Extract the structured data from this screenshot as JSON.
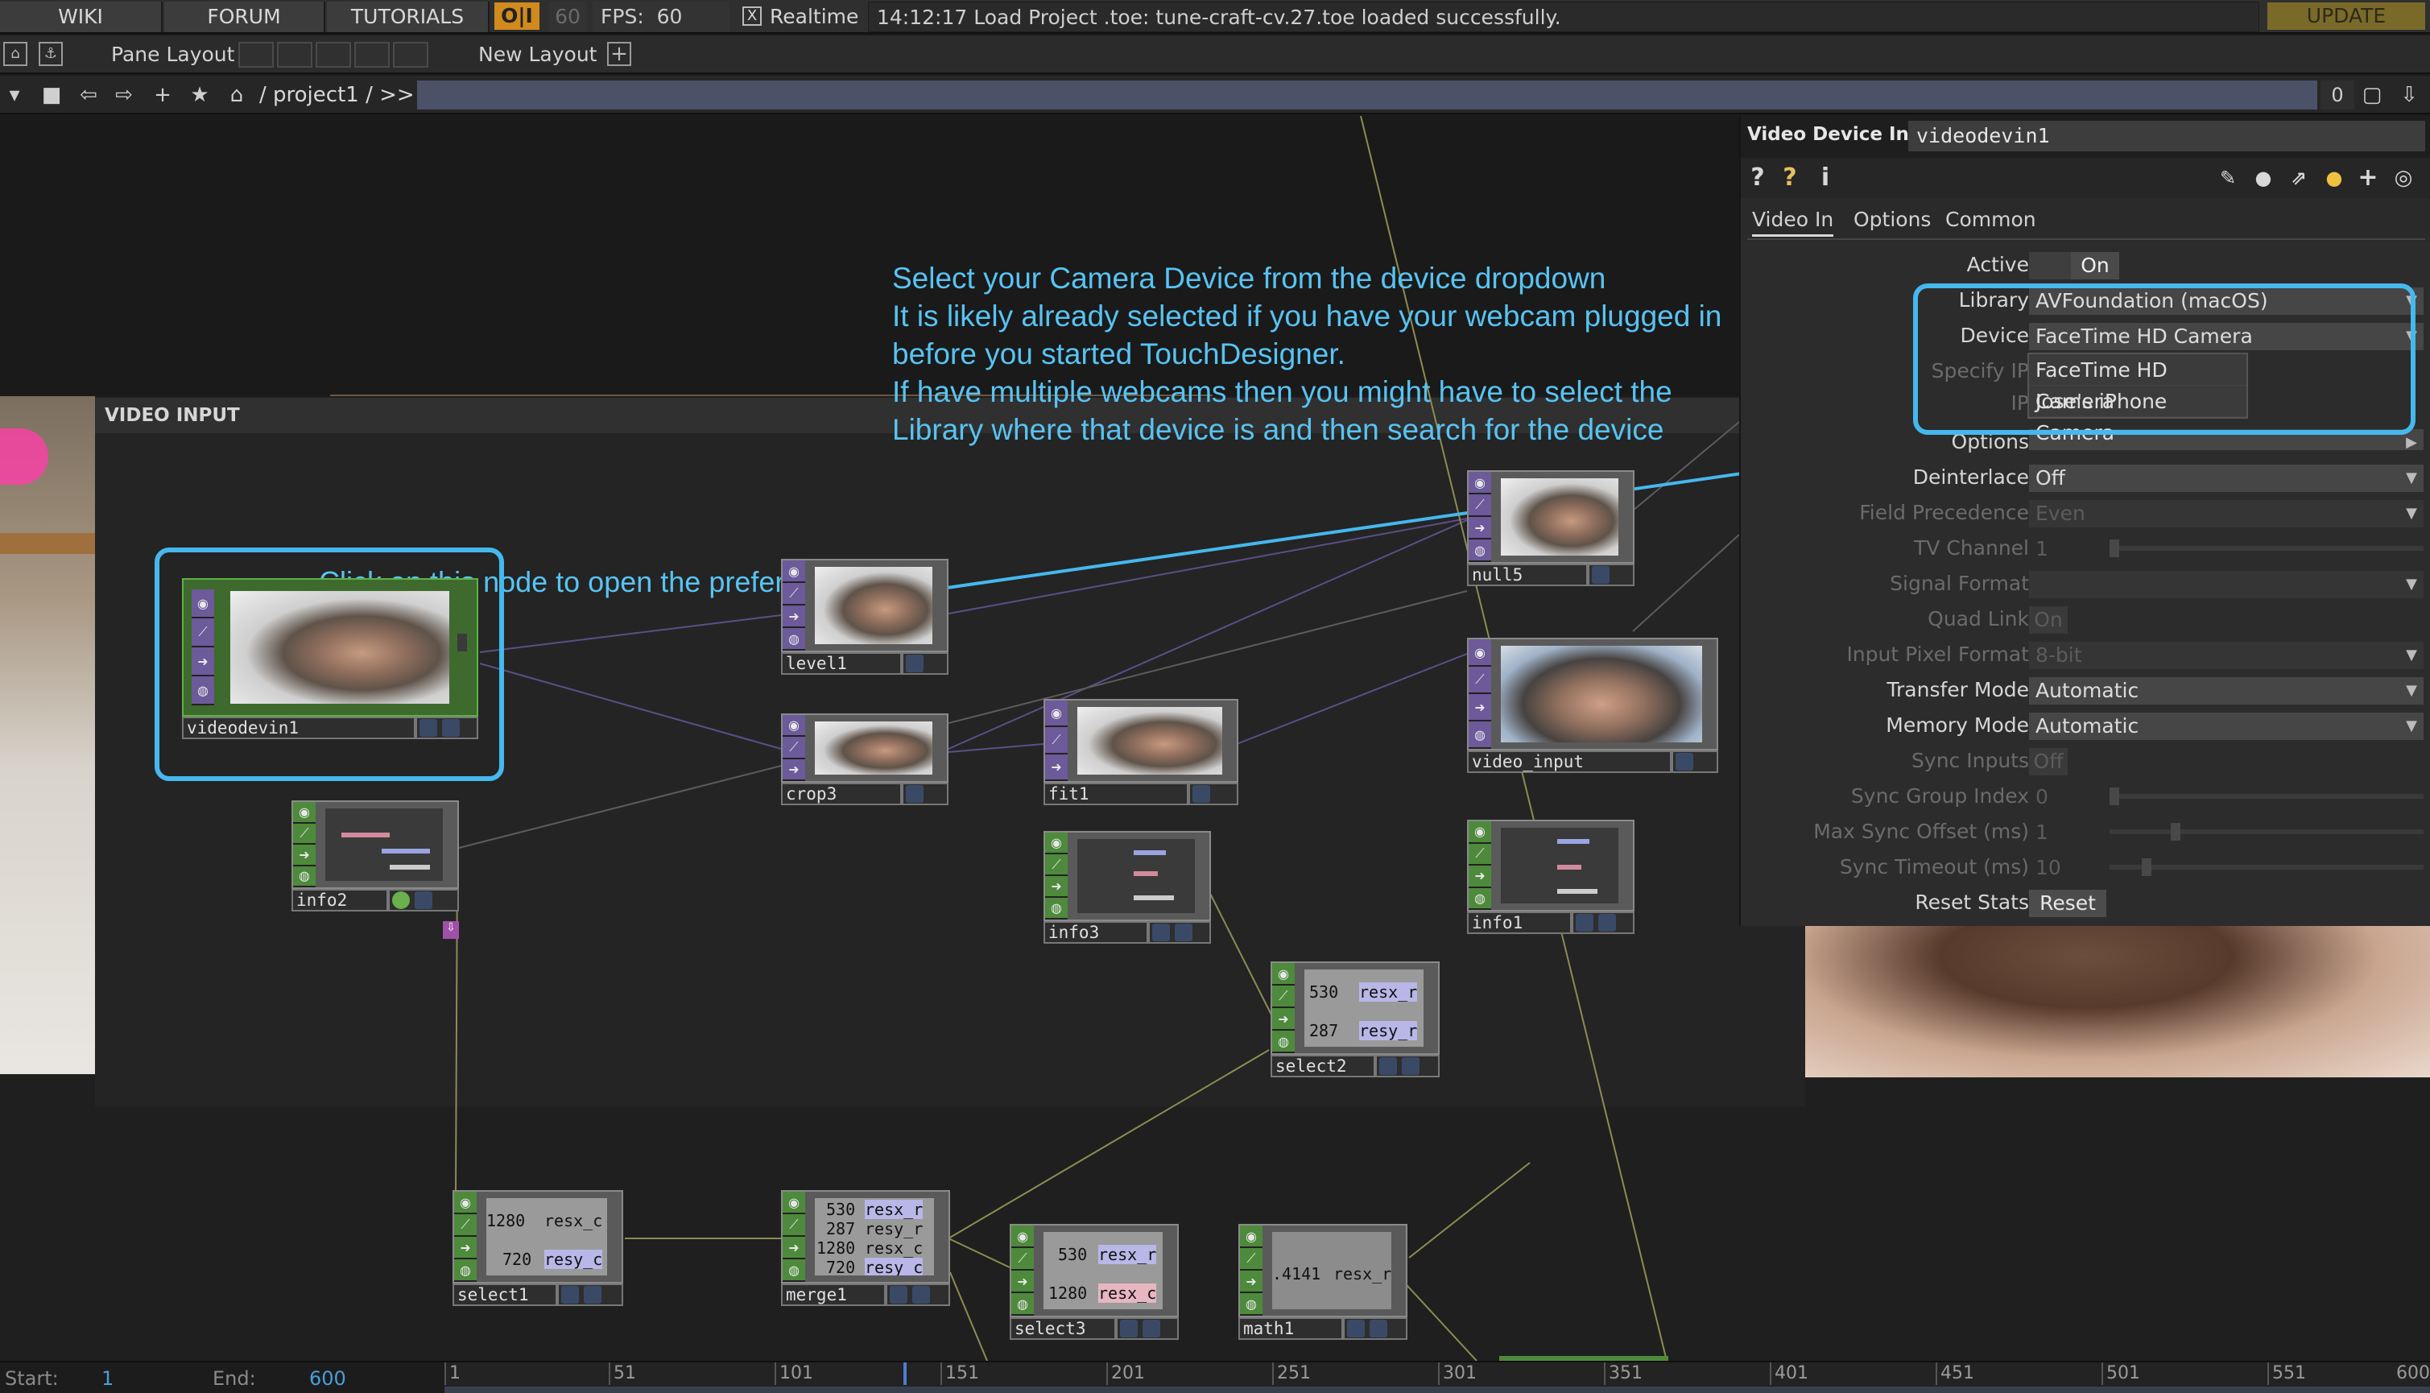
{
  "topbar": {
    "tabs": [
      "WIKI",
      "FORUM",
      "TUTORIALS"
    ],
    "oi": "O|I",
    "fps_dim": "60",
    "fps_label": "FPS:",
    "fps_value": "60",
    "realtime_check": "X",
    "realtime_label": "Realtime",
    "message": "14:12:17 Load Project .toe: tune-craft-cv.27.toe loaded successfully.",
    "update": "UPDATE"
  },
  "layoutbar": {
    "pane_layout": "Pane Layout",
    "new_layout": "New Layout",
    "add": "+"
  },
  "pathbar": {
    "path": "/ project1 / >>",
    "counter": "0"
  },
  "network": {
    "container_title": "VIDEO INPUT",
    "annotation_main": "Select your Camera Device from the device dropdown\nIt is likely already selected if you have your webcam plugged in before you started TouchDesigner.\nIf have multiple webcams then you might have to select the Library where that device is and then search for the device",
    "annotation_node": "Click on this node to open the preferences",
    "nodes": {
      "videodevin1": "videodevin1",
      "info2": "info2",
      "level1": "level1",
      "crop3": "crop3",
      "fit1": "fit1",
      "info3": "info3",
      "null5": "null5",
      "video_input": "video_input",
      "info1": "info1",
      "select2": "select2",
      "select1": "select1",
      "merge1": "merge1",
      "select3": "select3",
      "math1": "math1"
    },
    "chop_values": {
      "select2": [
        "530",
        "287"
      ],
      "select2_names": [
        "resx_r",
        "resy_r"
      ],
      "select1": [
        "1280",
        "720"
      ],
      "select1_names": [
        "resx_c",
        "resy_c"
      ],
      "merge1": [
        "530",
        "287",
        "1280",
        "720"
      ],
      "merge1_names": [
        "resx_r",
        "resy_r",
        "resx_c",
        "resy_c"
      ],
      "select3": [
        "530",
        "1280"
      ],
      "select3_names": [
        "resx_r",
        "resx_c"
      ],
      "math1": [
        ".4141"
      ],
      "math1_names": [
        "resx_r"
      ]
    }
  },
  "params": {
    "op_type": "Video Device In",
    "op_name": "videodevin1",
    "tabs": [
      "Video In",
      "Options",
      "Common"
    ],
    "rows": {
      "active": {
        "label": "Active",
        "value": "On"
      },
      "library": {
        "label": "Library",
        "value": "AVFoundation (macOS)"
      },
      "device": {
        "label": "Device",
        "value": "FaceTime HD Camera"
      },
      "specify_ip": {
        "label": "Specify IP"
      },
      "ip": {
        "label": "IP"
      },
      "options": {
        "label": "Options"
      },
      "deinterlace": {
        "label": "Deinterlace",
        "value": "Off"
      },
      "field_precedence": {
        "label": "Field Precedence",
        "value": "Even"
      },
      "tv_channel": {
        "label": "TV Channel",
        "value": "1"
      },
      "signal_format": {
        "label": "Signal Format",
        "value": ""
      },
      "quad_link": {
        "label": "Quad Link",
        "value": "On"
      },
      "input_pixel_format": {
        "label": "Input Pixel Format",
        "value": "8-bit"
      },
      "transfer_mode": {
        "label": "Transfer Mode",
        "value": "Automatic"
      },
      "memory_mode": {
        "label": "Memory Mode",
        "value": "Automatic"
      },
      "sync_inputs": {
        "label": "Sync Inputs",
        "value": "Off"
      },
      "sync_group_index": {
        "label": "Sync Group Index",
        "value": "0"
      },
      "max_sync_offset": {
        "label": "Max Sync Offset (ms)",
        "value": "1"
      },
      "sync_timeout": {
        "label": "Sync Timeout (ms)",
        "value": "10"
      },
      "reset_stats": {
        "label": "Reset Stats",
        "value": "Reset"
      }
    },
    "device_options": [
      "FaceTime HD Camera",
      "Jose's iPhone Camera"
    ]
  },
  "timeline": {
    "start_label": "Start:",
    "start_value": "1",
    "end_label": "End:",
    "end_value": "600",
    "ticks": [
      "1",
      "51",
      "101",
      "151",
      "201",
      "251",
      "301",
      "351",
      "401",
      "451",
      "501",
      "551",
      "600"
    ]
  },
  "colors": {
    "annotation": "#58c3f2",
    "top_node": "#6c5a9a",
    "chop_node": "#4e8a3c",
    "oi": "#d08a1e"
  }
}
